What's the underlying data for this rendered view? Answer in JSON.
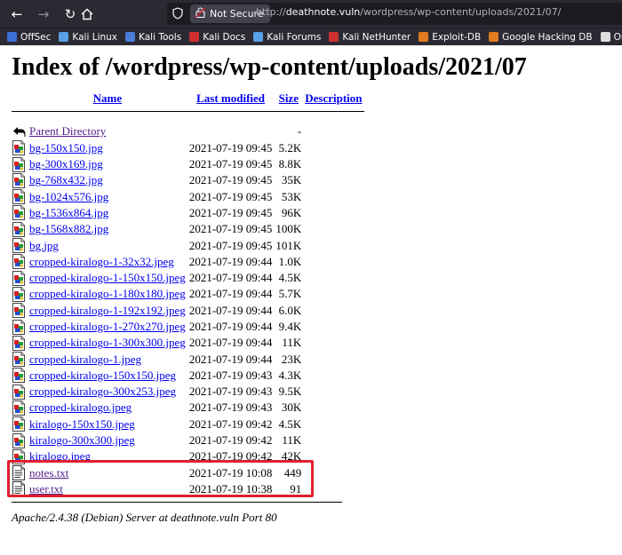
{
  "browser": {
    "url_insecure_label": "Not Secure",
    "url_prefix": "http://",
    "url_host": "deathnote.vuln",
    "url_path": "/wordpress/wp-content/uploads/2021/07/",
    "bookmarks": [
      {
        "label": "OffSec",
        "color": "#3d6fd8"
      },
      {
        "label": "Kali Linux",
        "color": "#5aa0e6"
      },
      {
        "label": "Kali Tools",
        "color": "#4b7ed8"
      },
      {
        "label": "Kali Docs",
        "color": "#d03030"
      },
      {
        "label": "Kali Forums",
        "color": "#5aa0e6"
      },
      {
        "label": "Kali NetHunter",
        "color": "#d03030"
      },
      {
        "label": "Exploit-DB",
        "color": "#e07b20"
      },
      {
        "label": "Google Hacking DB",
        "color": "#e07b20"
      },
      {
        "label": "Online Brainfuck De",
        "color": "#dddddd"
      }
    ]
  },
  "page": {
    "title": "Index of /wordpress/wp-content/uploads/2021/07",
    "columns": {
      "name": "Name",
      "last_modified": "Last modified",
      "size": "Size",
      "description": "Description"
    },
    "parent": {
      "label": "Parent Directory",
      "size": "-"
    },
    "rows": [
      {
        "name": "bg-150x150.jpg",
        "date": "2021-07-19 09:45",
        "size": "5.2K",
        "type": "image",
        "visited": false
      },
      {
        "name": "bg-300x169.jpg",
        "date": "2021-07-19 09:45",
        "size": "8.8K",
        "type": "image",
        "visited": false
      },
      {
        "name": "bg-768x432.jpg",
        "date": "2021-07-19 09:45",
        "size": "35K",
        "type": "image",
        "visited": false
      },
      {
        "name": "bg-1024x576.jpg",
        "date": "2021-07-19 09:45",
        "size": "53K",
        "type": "image",
        "visited": false
      },
      {
        "name": "bg-1536x864.jpg",
        "date": "2021-07-19 09:45",
        "size": "96K",
        "type": "image",
        "visited": false
      },
      {
        "name": "bg-1568x882.jpg",
        "date": "2021-07-19 09:45",
        "size": "100K",
        "type": "image",
        "visited": false
      },
      {
        "name": "bg.jpg",
        "date": "2021-07-19 09:45",
        "size": "101K",
        "type": "image",
        "visited": false
      },
      {
        "name": "cropped-kiralogo-1-32x32.jpeg",
        "date": "2021-07-19 09:44",
        "size": "1.0K",
        "type": "image",
        "visited": false
      },
      {
        "name": "cropped-kiralogo-1-150x150.jpeg",
        "date": "2021-07-19 09:44",
        "size": "4.5K",
        "type": "image",
        "visited": false
      },
      {
        "name": "cropped-kiralogo-1-180x180.jpeg",
        "date": "2021-07-19 09:44",
        "size": "5.7K",
        "type": "image",
        "visited": false
      },
      {
        "name": "cropped-kiralogo-1-192x192.jpeg",
        "date": "2021-07-19 09:44",
        "size": "6.0K",
        "type": "image",
        "visited": false
      },
      {
        "name": "cropped-kiralogo-1-270x270.jpeg",
        "date": "2021-07-19 09:44",
        "size": "9.4K",
        "type": "image",
        "visited": false
      },
      {
        "name": "cropped-kiralogo-1-300x300.jpeg",
        "date": "2021-07-19 09:44",
        "size": "11K",
        "type": "image",
        "visited": false
      },
      {
        "name": "cropped-kiralogo-1.jpeg",
        "date": "2021-07-19 09:44",
        "size": "23K",
        "type": "image",
        "visited": false
      },
      {
        "name": "cropped-kiralogo-150x150.jpeg",
        "date": "2021-07-19 09:43",
        "size": "4.3K",
        "type": "image",
        "visited": false
      },
      {
        "name": "cropped-kiralogo-300x253.jpeg",
        "date": "2021-07-19 09:43",
        "size": "9.5K",
        "type": "image",
        "visited": false
      },
      {
        "name": "cropped-kiralogo.jpeg",
        "date": "2021-07-19 09:43",
        "size": "30K",
        "type": "image",
        "visited": false
      },
      {
        "name": "kiralogo-150x150.jpeg",
        "date": "2021-07-19 09:42",
        "size": "4.5K",
        "type": "image",
        "visited": false
      },
      {
        "name": "kiralogo-300x300.jpeg",
        "date": "2021-07-19 09:42",
        "size": "11K",
        "type": "image",
        "visited": false
      },
      {
        "name": "kiralogo.jpeg",
        "date": "2021-07-19 09:42",
        "size": "42K",
        "type": "image",
        "visited": false
      },
      {
        "name": "notes.txt",
        "date": "2021-07-19 10:08",
        "size": "449",
        "type": "text",
        "visited": true
      },
      {
        "name": "user.txt",
        "date": "2021-07-19 10:38",
        "size": "91",
        "type": "text",
        "visited": true
      }
    ],
    "footer": "Apache/2.4.38 (Debian) Server at deathnote.vuln Port 80"
  },
  "colors": {
    "link": "#0000ee",
    "visited_link": "#551a8b",
    "highlight": "#e0202e",
    "toolbar": "#2b2a33"
  }
}
